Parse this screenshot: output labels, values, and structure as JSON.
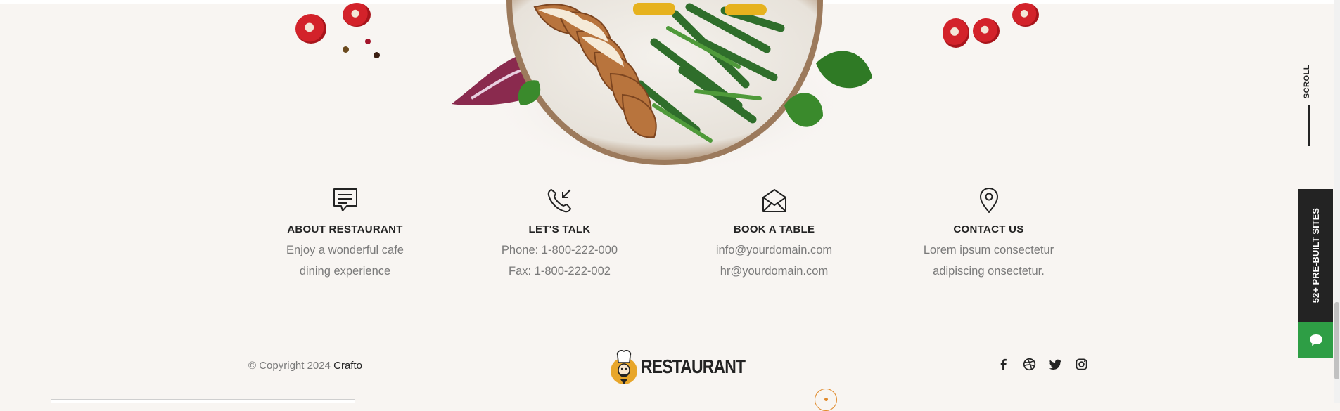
{
  "features": [
    {
      "title": "ABOUT RESTAURANT",
      "line1": "Enjoy a wonderful cafe",
      "line2": "dining experience",
      "icon": "chat-bubble-icon"
    },
    {
      "title": "LET'S TALK",
      "line1": "Phone: 1-800-222-000",
      "line2": "Fax: 1-800-222-002",
      "icon": "phone-incoming-icon"
    },
    {
      "title": "BOOK A TABLE",
      "line1": "info@yourdomain.com",
      "line2": "hr@yourdomain.com",
      "icon": "envelope-open-icon"
    },
    {
      "title": "CONTACT US",
      "line1": "Lorem ipsum consectetur",
      "line2": "adipiscing onsectetur.",
      "icon": "map-pin-icon"
    }
  ],
  "footer": {
    "copyright_prefix": "© Copyright 2024",
    "copyright_link": "Crafto",
    "logo_text": "RESTAURANT",
    "social": [
      "facebook-icon",
      "dribbble-icon",
      "twitter-icon",
      "instagram-icon"
    ]
  },
  "side": {
    "scroll_label": "SCROLL",
    "prebuilt_label": "52+ PRE-BUILT SITES"
  },
  "colors": {
    "background": "#f8f5f2",
    "text": "#232323",
    "muted": "#7a7a7a",
    "accent_orange": "#e08a2b",
    "chat_green": "#2e9e45",
    "dark_panel": "#232323"
  }
}
